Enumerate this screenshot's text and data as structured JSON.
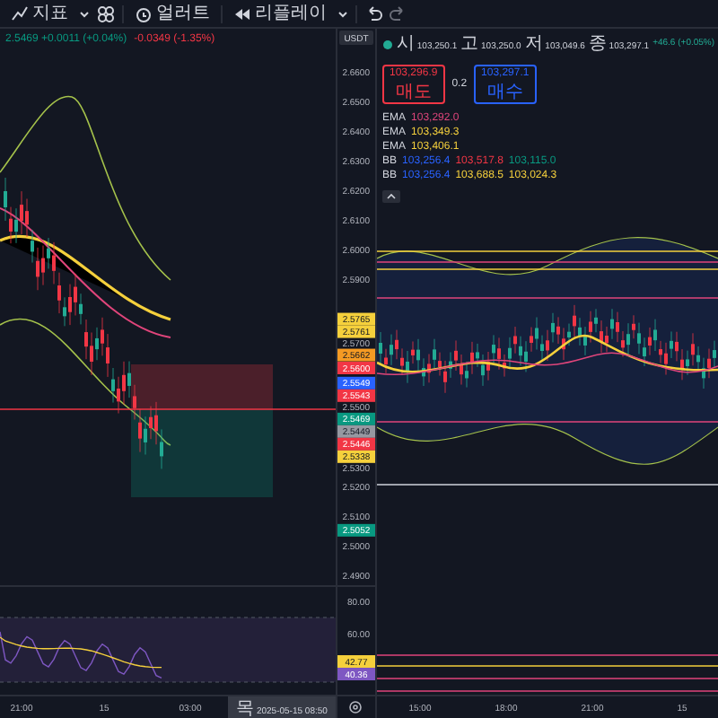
{
  "toolbar": {
    "indicators_label": "지표",
    "alert_label": "얼러트",
    "replay_label": "리플레이"
  },
  "left_chart": {
    "legend": [
      {
        "text": "2.5469 +0.0011 (+0.04%)",
        "color": "#089981"
      },
      {
        "text": "-0.0349 (-1.35%)",
        "color": "#f23645"
      }
    ],
    "currency": "USDT",
    "price_axis": [
      "2.6600",
      "2.6500",
      "2.6400",
      "2.6300",
      "2.6200",
      "2.6100",
      "2.6000",
      "2.5900",
      "2.5700",
      "2.5500",
      "2.5300",
      "2.5200",
      "2.5100",
      "2.5000",
      "2.4900"
    ],
    "badges": [
      {
        "value": "2.5765",
        "color": "#f5d03c"
      },
      {
        "value": "2.5761",
        "color": "#f5d03c"
      },
      {
        "value": "2.5662",
        "color": "#f59a23"
      },
      {
        "value": "2.5600",
        "color": "#f23645"
      },
      {
        "value": "2.5549",
        "color": "#2962ff"
      },
      {
        "value": "2.5543",
        "color": "#f23645"
      },
      {
        "value": "2.5469",
        "color": "#089981"
      },
      {
        "value": "2.5449",
        "color": "#9598a1"
      },
      {
        "value": "2.5446",
        "color": "#f23645"
      },
      {
        "value": "2.5338",
        "color": "#f5d03c"
      },
      {
        "value": "2.5052",
        "color": "#089981"
      }
    ],
    "rsi_axis": [
      "80.00",
      "60.00"
    ],
    "rsi_badges": [
      {
        "value": "42.77",
        "color": "#f5d03c"
      },
      {
        "value": "40.36",
        "color": "#7e57c2"
      }
    ],
    "time_axis": [
      "21:00",
      "15",
      "03:00"
    ],
    "cursor_date": {
      "weekday": "목",
      "datetime": "2025-05-15 08:50"
    }
  },
  "right_chart": {
    "ohlc": [
      {
        "label": "시",
        "value": "103,250.1"
      },
      {
        "label": "고",
        "value": "103,250.0"
      },
      {
        "label": "저",
        "value": "103,049.6"
      },
      {
        "label": "종",
        "value": "103,297.1"
      }
    ],
    "change": "+46.6 (+0.05%)",
    "sell": {
      "price": "103,296.9",
      "label": "매도"
    },
    "spread": "0.2",
    "buy": {
      "price": "103,297.1",
      "label": "매수"
    },
    "indicators": [
      {
        "name": "EMA",
        "values": [
          {
            "text": "103,292.0",
            "color": "#e0457b"
          }
        ]
      },
      {
        "name": "EMA",
        "values": [
          {
            "text": "103,349.3",
            "color": "#f5d03c"
          }
        ]
      },
      {
        "name": "EMA",
        "values": [
          {
            "text": "103,406.1",
            "color": "#f5d03c"
          }
        ]
      },
      {
        "name": "BB",
        "values": [
          {
            "text": "103,256.4",
            "color": "#2962ff"
          },
          {
            "text": "103,517.8",
            "color": "#f23645"
          },
          {
            "text": "103,115.0",
            "color": "#089981"
          }
        ]
      },
      {
        "name": "BB",
        "values": [
          {
            "text": "103,256.4",
            "color": "#2962ff"
          },
          {
            "text": "103,688.5",
            "color": "#f5d03c"
          },
          {
            "text": "103,024.3",
            "color": "#f5d03c"
          }
        ]
      }
    ],
    "time_axis": [
      "15:00",
      "18:00",
      "21:00",
      "15"
    ]
  }
}
